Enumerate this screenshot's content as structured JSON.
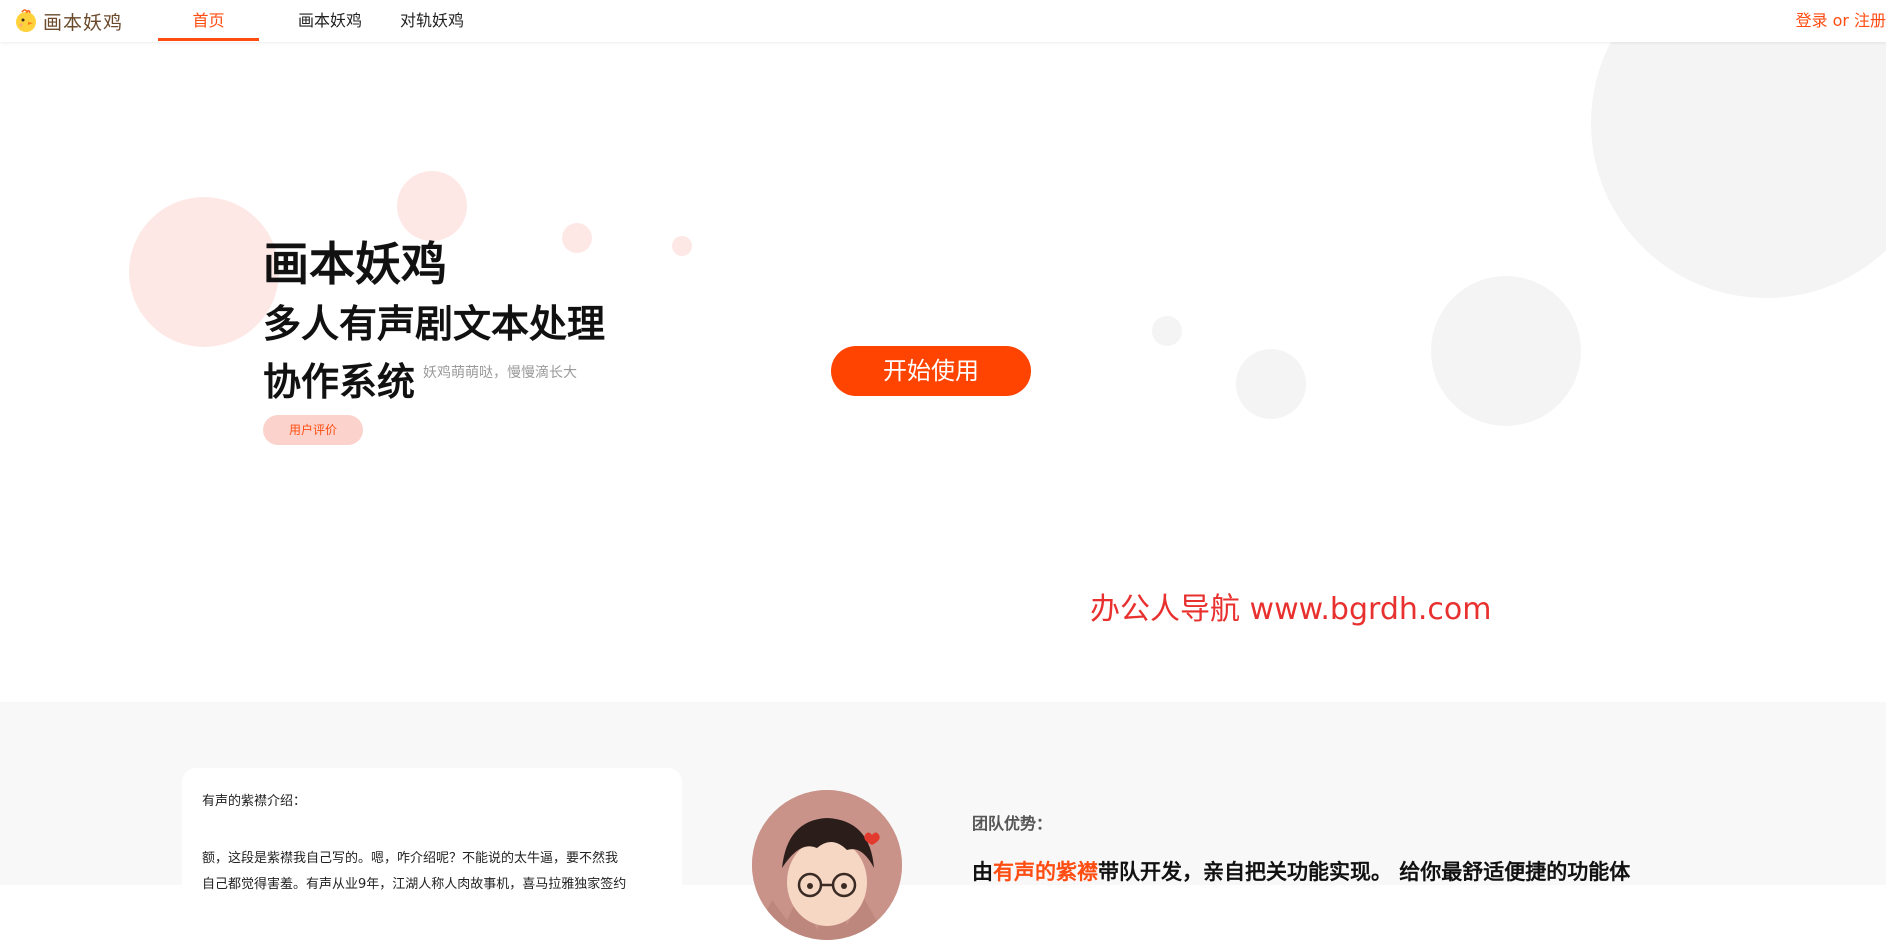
{
  "nav": {
    "logo_text": "画本妖鸡",
    "items": [
      {
        "label": "首页",
        "active": true
      },
      {
        "label": "画本妖鸡",
        "active": false
      },
      {
        "label": "对轨妖鸡",
        "active": false
      }
    ],
    "login_label": "登录",
    "separator": "or",
    "register_label": "注册"
  },
  "hero": {
    "title": "画本妖鸡",
    "subtitle_line1": "多人有声剧文本处理",
    "subtitle_line2": "协作系统",
    "slogan": "妖鸡萌萌哒，慢慢滴长大",
    "review_button": "用户评价",
    "start_button": "开始使用",
    "watermark": "办公人导航 www.bgrdh.com"
  },
  "intro": {
    "title": "有声的紫襟介绍：",
    "body_line1": "额，这段是紫襟我自己写的。嗯，咋介绍呢？不能说的太牛逼，要不然我",
    "body_line2": "自己都觉得害羞。有声从业9年，江湖人称人肉故事机，喜马拉雅独家签约"
  },
  "team": {
    "label": "团队优势：",
    "line_prefix": "由",
    "line_highlight": "有声的紫襟",
    "line_suffix": "带队开发，亲自把关功能实现。 给你最舒适便捷的功能体"
  },
  "colors": {
    "accent": "#ff4d12",
    "button": "#ff4300",
    "pink_circle": "#fde8e6",
    "gray_circle": "#f4f4f4",
    "watermark": "#e8302e"
  },
  "icons": {
    "logo": "chick-icon",
    "avatar": "cartoon-avatar"
  }
}
